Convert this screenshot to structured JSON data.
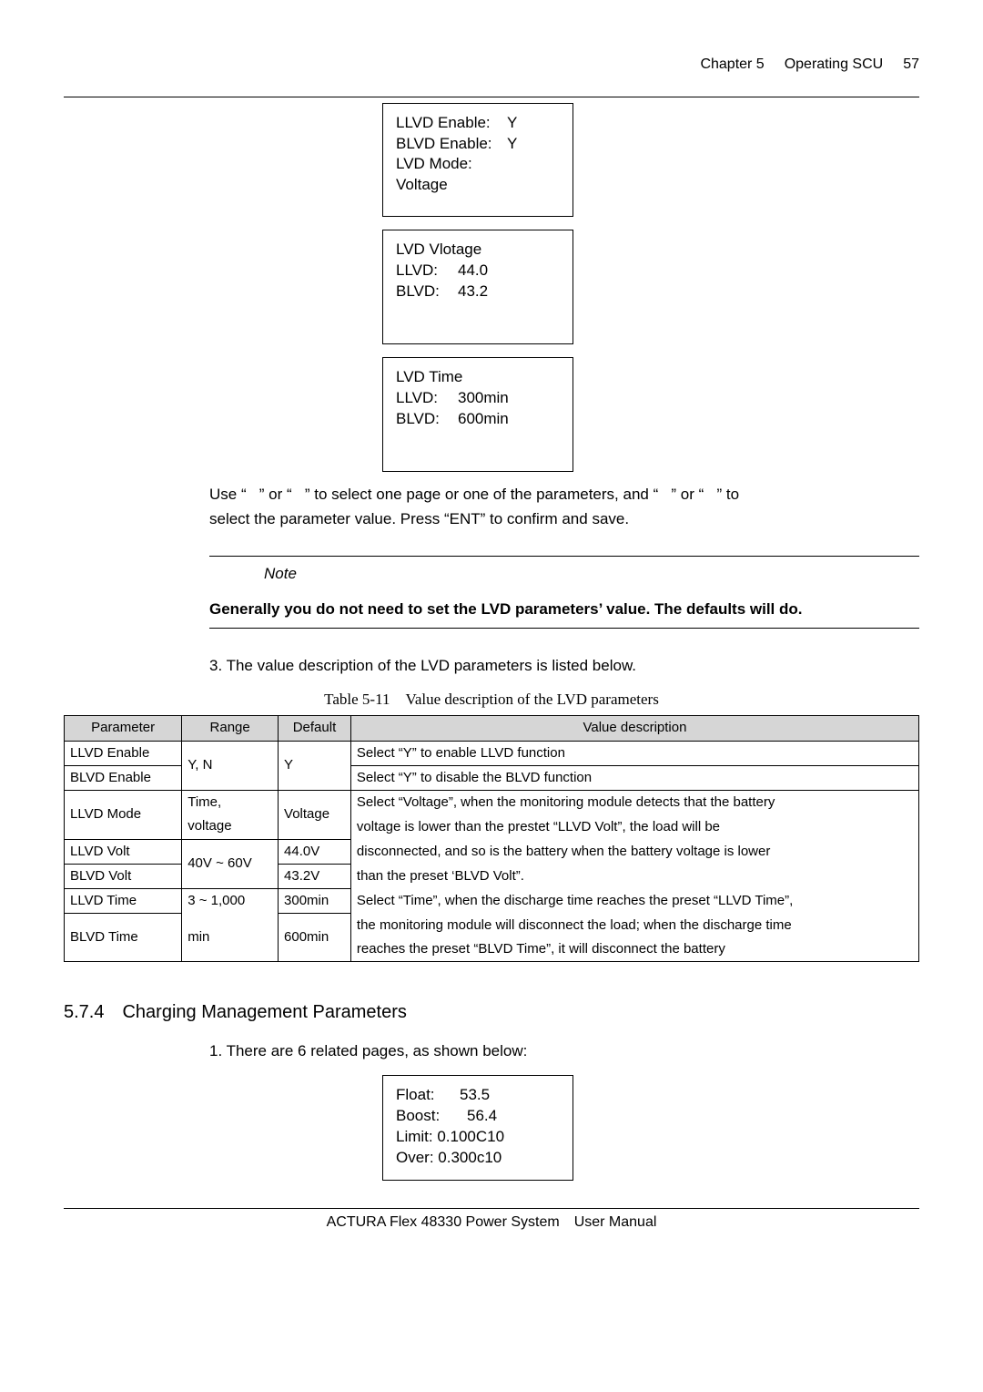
{
  "header": {
    "chapter": "Chapter 5",
    "title": "Operating SCU",
    "page": "57"
  },
  "screens": {
    "a": {
      "row1_l": "LLVD Enable:",
      "row1_v": "Y",
      "row2_l": "BLVD Enable:",
      "row2_v": "Y",
      "row3": "LVD Mode:",
      "row4": "Voltage"
    },
    "b": {
      "title": "LVD Vlotage",
      "row1_l": "LLVD:",
      "row1_v": "44.0",
      "row2_l": "BLVD:",
      "row2_v": "43.2"
    },
    "c": {
      "title": "LVD Time",
      "row1_l": "LLVD:",
      "row1_v": "300min",
      "row2_l": "BLVD:",
      "row2_v": "600min"
    }
  },
  "para1a": "Use “   ” or “   ” to select one page or one of the parameters, and “   ” or “   ” to",
  "para1b": "select the parameter value. Press “ENT” to confirm and save.",
  "note": {
    "label": "Note",
    "bold1": "Generally you do not need to set the LVD parameters’ value. The defaults will do."
  },
  "step3": "3. The value description of the LVD parameters is listed below.",
  "tableCaption": "Table 5-11 Value description of the LVD parameters",
  "th": {
    "c1": "Parameter",
    "c2": "Range",
    "c3": "Default",
    "c4": "Value description"
  },
  "rows": {
    "r1c1": "LLVD Enable",
    "r2c1": "BLVD Enable",
    "r12c2": "Y, N",
    "r12c3": "Y",
    "r1c4": "Select “Y” to enable LLVD function",
    "r2c4": "Select “Y” to disable the BLVD function",
    "r3c1": "LLVD Mode",
    "r3c2a": "Time,",
    "r3c2b": "voltage",
    "r3c3": "Voltage",
    "r4c1": "LLVD Volt",
    "r5c1": "BLVD Volt",
    "r45c2": "40V ~ 60V",
    "r4c3": "44.0V",
    "r5c3": "43.2V",
    "r6c1": "LLVD Time",
    "r7c1": "BLVD Time",
    "r67c2a": "3 ~ 1,000",
    "r67c2b": "min",
    "r6c3": "300min",
    "r7c3": "600min",
    "desc_l1": "Select “Voltage”, when the monitoring module detects that the battery",
    "desc_l2": "voltage is lower than the prestet “LLVD Volt”, the load will be",
    "desc_l3": "disconnected, and so is the battery when the battery voltage is lower",
    "desc_l4": "than the preset ‘BLVD Volt”.",
    "desc_l5": "Select “Time”, when the discharge time reaches the preset “LLVD Time”,",
    "desc_l6": "the monitoring module will disconnect the load; when the discharge time",
    "desc_l7": "reaches the preset “BLVD Time”, it will disconnect the battery"
  },
  "h3": "5.7.4 Charging Management Parameters",
  "step1": "1. There are 6 related pages, as shown below:",
  "screen2": {
    "row1_l": "Float:",
    "row1_v": "53.5",
    "row2_l": "Boost:",
    "row2_v": "56.4",
    "row3": "Limit: 0.100C10",
    "row4": "Over: 0.300c10"
  },
  "footer": "ACTURA Flex 48330 Power System User Manual"
}
